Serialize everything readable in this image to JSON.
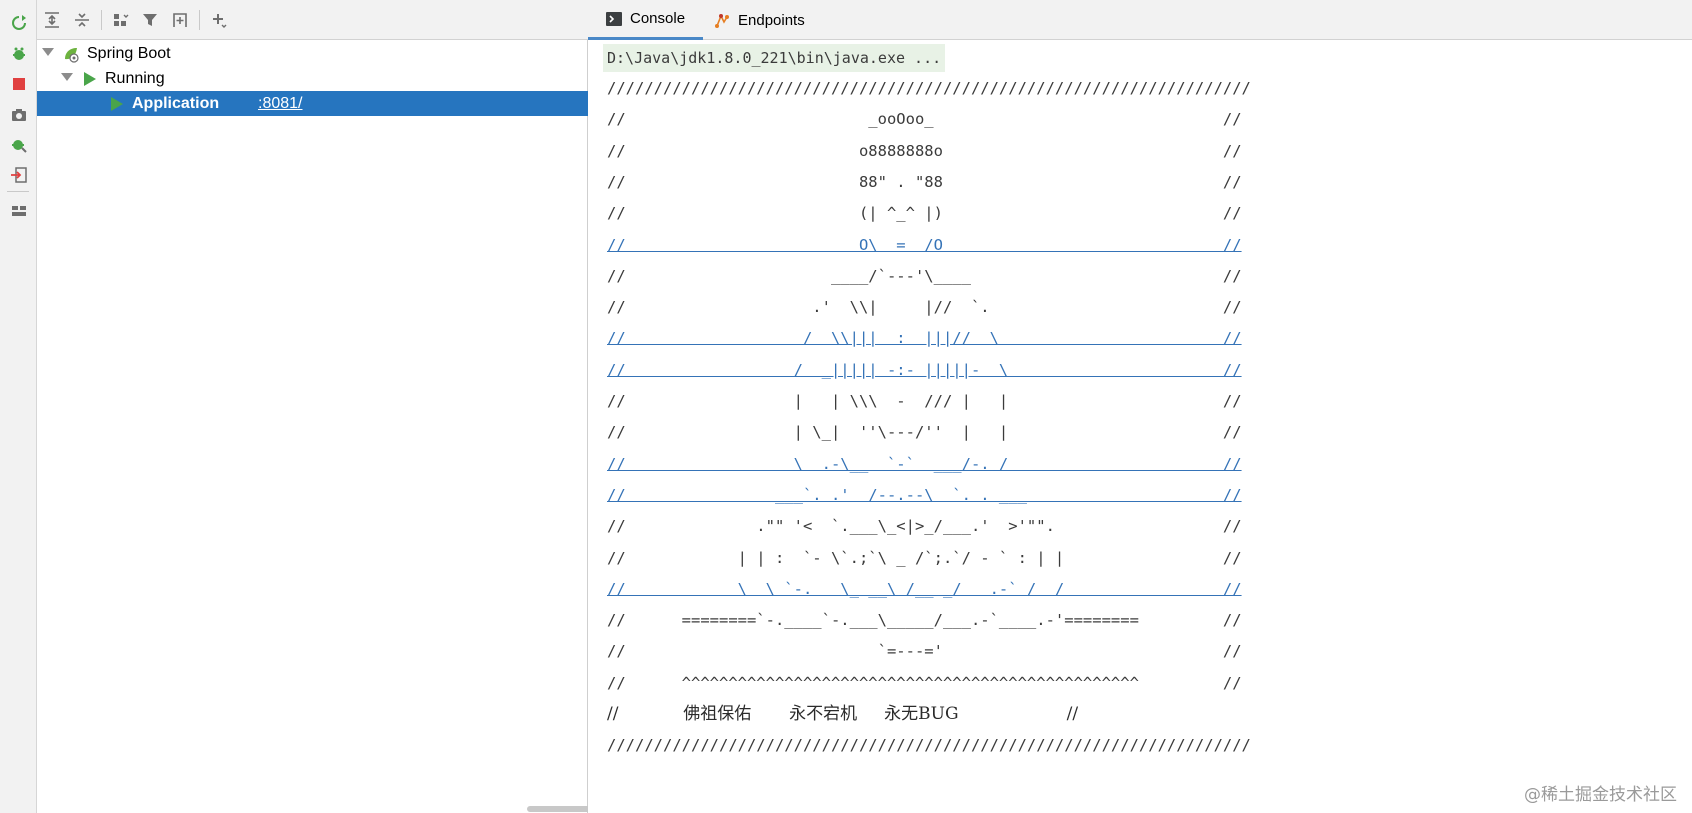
{
  "left_toolbar": {
    "icons": [
      "rerun-icon",
      "debug-icon",
      "stop-icon",
      "snapshot-icon",
      "gear-debug-icon",
      "exit-icon",
      "layout-icon"
    ]
  },
  "services_toolbar": {
    "icons": [
      "expand-all-icon",
      "collapse-all-icon",
      "group-icon",
      "filter-icon",
      "add-tree-icon",
      "add-icon"
    ]
  },
  "tree": {
    "root": {
      "label": "Spring Boot"
    },
    "group": {
      "label": "Running"
    },
    "app": {
      "label": "Application",
      "port": ":8081/"
    }
  },
  "tabs": [
    {
      "label": "Console",
      "active": true
    },
    {
      "label": "Endpoints",
      "active": false
    }
  ],
  "console": {
    "command": "D:\\Java\\jdk1.8.0_221\\bin\\java.exe ...",
    "lines": [
      "/////////////////////////////////////////////////////////////////////",
      "//                          _ooOoo_                               //",
      "//                         o8888888o                              //",
      "//                         88\" . \"88                              //",
      "//                         (| ^_^ |)                              //",
      "//                         O\\  =  /O                              //",
      "//                      ____/`---'\\____                           //",
      "//                    .'  \\\\|     |//  `.                         //",
      "//                   /  \\\\|||  :  |||//  \\                        //",
      "//                  /  _||||| -:- |||||-  \\                       //",
      "//                  |   | \\\\\\  -  /// |   |                       //",
      "//                  | \\_|  ''\\---/''  |   |                       //",
      "//                  \\  .-\\__  `-`  ___/-. /                       //",
      "//                ___`. .'  /--.--\\  `. . ___                     //",
      "//              .\"\" '<  `.___\\_<|>_/___.'  >'\"\".                  //",
      "//            | | :  `- \\`.;`\\ _ /`;.`/ - ` : | |                 //",
      "//            \\  \\ `-.   \\_ __\\ /__ _/   .-` /  /                 //",
      "//      ========`-.____`-.___\\_____/___.-`____.-'========         //",
      "//                           `=---='                              //",
      "//      ^^^^^^^^^^^^^^^^^^^^^^^^^^^^^^^^^^^^^^^^^^^^^^^^^         //",
      "//            佛祖保佑       永不宕机     永无BUG                    //",
      "/////////////////////////////////////////////////////////////////////"
    ]
  },
  "watermark": "@稀土掘金技术社区",
  "colors": {
    "selection": "#2675bf",
    "run_green": "#4aa54a",
    "link_blue": "#3573b7",
    "stop_red": "#e04040"
  }
}
